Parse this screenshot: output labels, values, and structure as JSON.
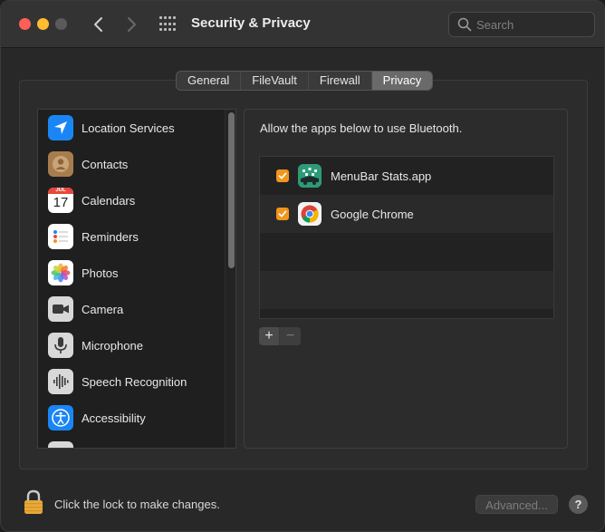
{
  "window": {
    "title": "Security & Privacy",
    "search_placeholder": "Search"
  },
  "tabs": [
    {
      "label": "General",
      "active": false
    },
    {
      "label": "FileVault",
      "active": false
    },
    {
      "label": "Firewall",
      "active": false
    },
    {
      "label": "Privacy",
      "active": true
    }
  ],
  "sidebar": {
    "items": [
      {
        "label": "Location Services",
        "icon": "location-arrow-icon",
        "color": "#1a86f5"
      },
      {
        "label": "Contacts",
        "icon": "contacts-icon",
        "color": "#a77d4e"
      },
      {
        "label": "Calendars",
        "icon": "calendar-icon",
        "color": "#ffffff",
        "month": "JUL",
        "day": "17"
      },
      {
        "label": "Reminders",
        "icon": "reminders-icon",
        "color": "#ffffff"
      },
      {
        "label": "Photos",
        "icon": "photos-icon",
        "color": "#ffffff"
      },
      {
        "label": "Camera",
        "icon": "camera-icon",
        "color": "#8e8e8e"
      },
      {
        "label": "Microphone",
        "icon": "microphone-icon",
        "color": "#9a9a9a"
      },
      {
        "label": "Speech Recognition",
        "icon": "waveform-icon",
        "color": "#9a9a9a"
      },
      {
        "label": "Accessibility",
        "icon": "accessibility-icon",
        "color": "#1a86f5"
      }
    ]
  },
  "panel": {
    "heading": "Allow the apps below to use Bluetooth.",
    "apps": [
      {
        "name": "MenuBar Stats.app",
        "checked": true,
        "icon": "menubar-stats-icon"
      },
      {
        "name": "Google Chrome",
        "checked": true,
        "icon": "chrome-icon"
      }
    ],
    "add_label": "+",
    "remove_label": "−"
  },
  "footer": {
    "lock_text": "Click the lock to make changes.",
    "advanced_label": "Advanced...",
    "help_label": "?"
  },
  "colors": {
    "accent_checkbox": "#f0961e",
    "lock": "#e8a93a"
  }
}
